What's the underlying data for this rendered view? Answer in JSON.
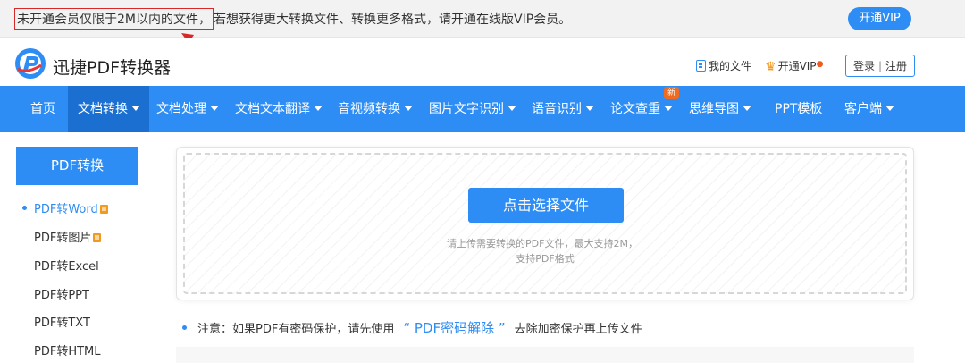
{
  "topbar": {
    "notice_highlight": "未开通会员仅限于2M以内的文件，",
    "notice_rest": "若想获得更大转换文件、转换更多格式，请开通在线版VIP会员。",
    "vip_button": "开通VIP"
  },
  "header": {
    "brand": "迅捷PDF转换器",
    "my_files": "我的文件",
    "open_vip": "开通VIP",
    "login": "登录",
    "separator": "|",
    "register": "注册"
  },
  "nav": {
    "items": [
      {
        "label": "首页",
        "dropdown": false
      },
      {
        "label": "文档转换",
        "dropdown": true,
        "active": true
      },
      {
        "label": "文档处理",
        "dropdown": true
      },
      {
        "label": "文档文本翻译",
        "dropdown": true
      },
      {
        "label": "音视频转换",
        "dropdown": true
      },
      {
        "label": "图片文字识别",
        "dropdown": true
      },
      {
        "label": "语音识别",
        "dropdown": true
      },
      {
        "label": "论文查重",
        "dropdown": true
      },
      {
        "label": "思维导图",
        "dropdown": true
      },
      {
        "label": "PPT模板",
        "dropdown": false
      },
      {
        "label": "客户端",
        "dropdown": true
      }
    ],
    "new_badge": "新"
  },
  "sidebar": {
    "title": "PDF转换",
    "items": [
      {
        "label": "PDF转Word",
        "vip": true,
        "active": true
      },
      {
        "label": "PDF转图片",
        "vip": true
      },
      {
        "label": "PDF转Excel"
      },
      {
        "label": "PDF转PPT"
      },
      {
        "label": "PDF转TXT"
      },
      {
        "label": "PDF转HTML"
      }
    ]
  },
  "upload": {
    "button": "点击选择文件",
    "hint_line1": "请上传需要转换的PDF文件，最大支持2M，",
    "hint_line2": "支持PDF格式"
  },
  "note": {
    "prefix": "注意：如果PDF有密码保护，请先使用",
    "link": "“ PDF密码解除 ”",
    "suffix": "去除加密保护再上传文件"
  },
  "colors": {
    "primary": "#2d8df4",
    "nav_active": "#1a6fd1",
    "highlight_border": "#d9282a",
    "vip_orange": "#f29a1d"
  }
}
